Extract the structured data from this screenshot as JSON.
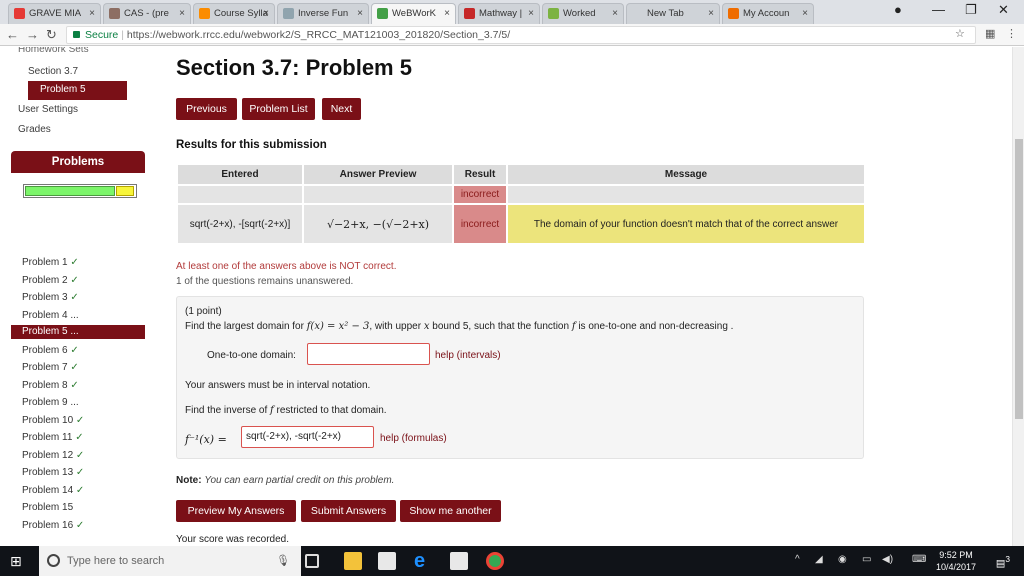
{
  "tabs": [
    {
      "label": "GRAVE MIA",
      "fav": "#e53935"
    },
    {
      "label": "CAS - (pre",
      "fav": "#8d6e63"
    },
    {
      "label": "Course Sylla",
      "fav": "#fb8c00"
    },
    {
      "label": "Inverse Fun",
      "fav": "#90a4ae"
    },
    {
      "label": "WeBWorK",
      "fav": "#43a047"
    },
    {
      "label": "Mathway | ",
      "fav": "#c62828"
    },
    {
      "label": "Worked",
      "fav": "#7cb342"
    },
    {
      "label": "New Tab",
      "fav": "#cfd3d8"
    },
    {
      "label": "My Accoun",
      "fav": "#ef6c00"
    }
  ],
  "address": {
    "secure": "Secure",
    "url": "https://webwork.rrcc.edu/webwork2/S_RRCC_MAT121003_201820/Section_3.7/5/"
  },
  "sidebar": {
    "homework_sets": "Homework Sets",
    "section": "Section 3.7",
    "problem": "Problem 5",
    "user_settings": "User Settings",
    "grades": "Grades",
    "problems_header": "Problems",
    "progress_correct": 0.82,
    "progress_incorrect": 0.16,
    "items": [
      {
        "label": "Problem 1",
        "mark": "✓"
      },
      {
        "label": "Problem 2",
        "mark": "✓"
      },
      {
        "label": "Problem 3",
        "mark": "✓"
      },
      {
        "label": "Problem 4",
        "mark": "..."
      },
      {
        "label": "Problem 5",
        "mark": "..."
      },
      {
        "label": "Problem 6",
        "mark": "✓"
      },
      {
        "label": "Problem 7",
        "mark": "✓"
      },
      {
        "label": "Problem 8",
        "mark": "✓"
      },
      {
        "label": "Problem 9",
        "mark": "..."
      },
      {
        "label": "Problem 10",
        "mark": "✓"
      },
      {
        "label": "Problem 11",
        "mark": "✓"
      },
      {
        "label": "Problem 12",
        "mark": "✓"
      },
      {
        "label": "Problem 13",
        "mark": "✓"
      },
      {
        "label": "Problem 14",
        "mark": "✓"
      },
      {
        "label": "Problem 15",
        "mark": ""
      },
      {
        "label": "Problem 16",
        "mark": "✓"
      }
    ]
  },
  "main": {
    "title": "Section 3.7: Problem 5",
    "nav": {
      "previous": "Previous",
      "list": "Problem List",
      "next": "Next"
    },
    "results_heading": "Results for this submission",
    "table": {
      "headers": [
        "Entered",
        "Answer Preview",
        "Result",
        "Message"
      ],
      "row1": {
        "result": "incorrect"
      },
      "row2": {
        "entered": "sqrt(-2+x), -[sqrt(-2+x)]",
        "preview": "√−2+x, −(√−2+x)",
        "result": "incorrect",
        "message": "The domain of your function doesn't match that of the correct answer"
      }
    },
    "at_least": "At least one of the answers above is NOT correct.",
    "unanswered": "1 of the questions remains unanswered.",
    "problem": {
      "points": "(1 point)",
      "q_find": "Find the largest domain for",
      "q_func": "f(x) = x² − 3",
      "q_with": ", with upper",
      "q_x": "x",
      "q_rest": "bound 5, such that the function",
      "q_f": "f",
      "q_end": "is one-to-one and non-decreasing .",
      "domain_label": "One-to-one domain:",
      "domain_value": "",
      "help_intervals": "help (intervals)",
      "interval_note": "Your answers must be in interval notation.",
      "inverse_find": "Find the inverse of",
      "inverse_f": "f",
      "inverse_rest": "restricted to that domain.",
      "inverse_lhs": "f⁻¹(x) =",
      "inverse_value": "sqrt(-2+x), -sqrt(-2+x)",
      "help_formulas": "help (formulas)"
    },
    "note_bold": "Note:",
    "note_text": "You can earn partial credit on this problem.",
    "buttons": {
      "preview": "Preview My Answers",
      "submit": "Submit Answers",
      "another": "Show me another"
    },
    "recorded": "Your score was recorded."
  },
  "taskbar": {
    "search_placeholder": "Type here to search",
    "time": "9:52 PM",
    "date": "10/4/2017",
    "notif_count": "3"
  }
}
